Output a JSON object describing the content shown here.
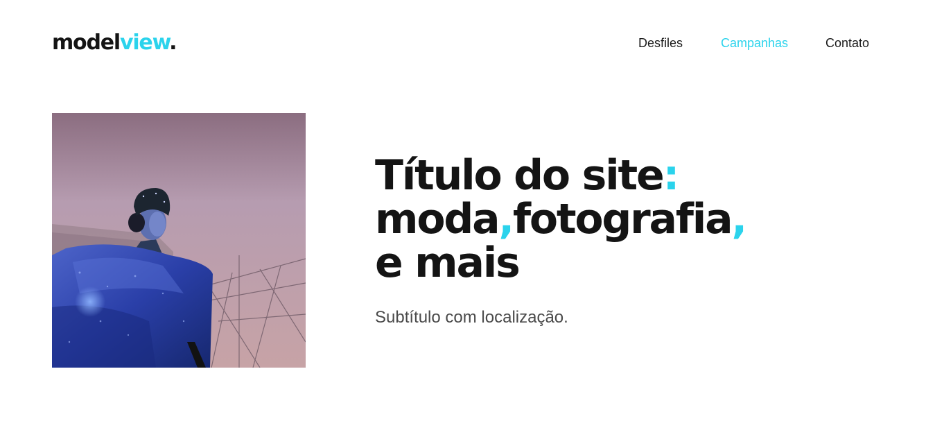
{
  "brand": {
    "name_main": "model",
    "name_accent": "view",
    "dot": "."
  },
  "nav": {
    "items": [
      {
        "label": "Desfiles",
        "active": false
      },
      {
        "label": "Campanhas",
        "active": true
      },
      {
        "label": "Contato",
        "active": false
      }
    ]
  },
  "hero": {
    "title": {
      "line1": "Título do site",
      "line1_punct": ":",
      "line2_a": "moda",
      "line2_punct_a": ",",
      "line2_b": "fotografia",
      "line2_punct_b": ",",
      "line3": "e mais"
    },
    "subtitle": "Subtítulo com localização.",
    "image_icon": "fashion-photo"
  },
  "colors": {
    "accent": "#2bd3ec",
    "text": "#141414",
    "muted": "#4a4a4a"
  }
}
